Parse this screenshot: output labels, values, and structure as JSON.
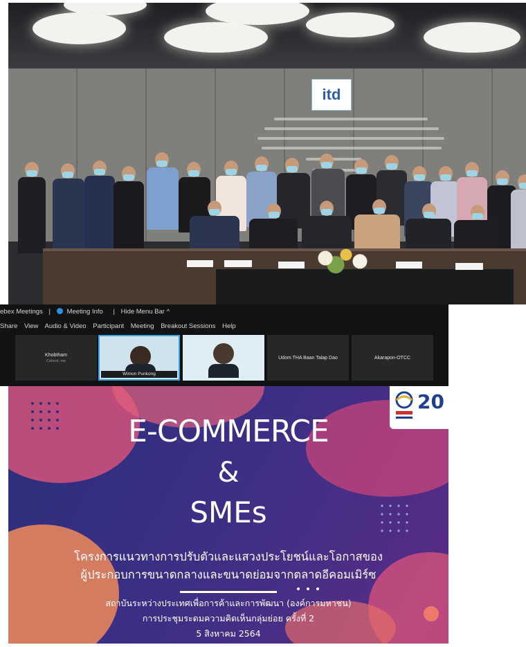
{
  "photo": {
    "logo_text": "itd"
  },
  "webex": {
    "titlebar": {
      "app": "ebex Meetings",
      "sep1": "|",
      "meeting_info": "Meeting Info",
      "sep2": "|",
      "hide_menu": "Hide Menu Bar ^"
    },
    "menu": [
      "Share",
      "View",
      "Audio & Video",
      "Participant",
      "Meeting",
      "Breakout Sessions",
      "Help"
    ],
    "tiles": [
      {
        "name": "Khobtham",
        "sub": "Cohost, me"
      },
      {
        "name": "Wimon Punkong",
        "sub": ""
      },
      {
        "name": "",
        "sub": ""
      },
      {
        "name": "Udom THA Baan Talap Dao",
        "sub": ""
      },
      {
        "name": "Akarapon-OTCC",
        "sub": ""
      }
    ]
  },
  "slide": {
    "title": "E-COMMERCE",
    "amp": "&",
    "smes": "SMEs",
    "line1": "โครงการแนวทางการปรับตัวและแสวงประโยชน์และโอกาสของ",
    "line2": "ผู้ประกอบการขนาดกลางและขนาดย่อมจากตลาดอีคอมเมิร์ซ",
    "line3": "สถาบันระหว่างประเทศเพื่อการค้าและการพัฒนา (องค์การมหาชน)",
    "line4": "การประชุมระดมความคิดเห็นกลุ่มย่อย ครั้งที่ 2",
    "line5": "5 สิงหาคม 2564",
    "logo_num": "20"
  },
  "colors": {
    "accent_blue": "#38a6e6",
    "slide_bg": "#3b2f85",
    "blob_pink": "#d4517a",
    "blob_orange": "#f08a5a"
  }
}
